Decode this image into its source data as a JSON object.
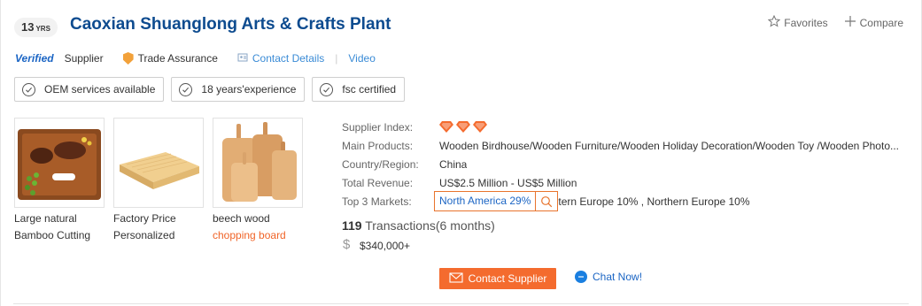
{
  "header": {
    "years_number": "13",
    "years_unit": "YRS",
    "company_name": "Caoxian Shuanglong Arts & Crafts Plant",
    "favorites_label": "Favorites",
    "compare_label": "Compare"
  },
  "meta": {
    "verified_label": "Verified",
    "supplier_label": "Supplier",
    "trade_assurance_label": "Trade Assurance",
    "contact_details_label": "Contact Details",
    "video_label": "Video"
  },
  "tags": [
    {
      "label": "OEM services available"
    },
    {
      "label": "18 years'experience"
    },
    {
      "label": "fsc certified"
    }
  ],
  "products": [
    {
      "line1": "Large natural",
      "line2": "Bamboo Cutting"
    },
    {
      "line1": "Factory Price",
      "line2": "Personalized"
    },
    {
      "line1": "beech wood",
      "line2": "chopping board"
    }
  ],
  "info": {
    "supplier_index_label": "Supplier Index:",
    "supplier_index_diamonds": 3,
    "main_products_label": "Main Products:",
    "main_products_value": "Wooden Birdhouse/Wooden Furniture/Wooden Holiday Decoration/Wooden Toy /Wooden Photo...",
    "country_label": "Country/Region:",
    "country_value": "China",
    "revenue_label": "Total Revenue:",
    "revenue_value": "US$2.5 Million - US$5 Million",
    "markets_label": "Top 3 Markets:",
    "markets_first": "North America 29%",
    "markets_rest": "tern Europe 10% , Northern Europe 10%"
  },
  "transactions": {
    "count": "119",
    "label": " Transactions(6 months)",
    "amount": "$340,000+"
  },
  "actions": {
    "contact_supplier_label": "Contact Supplier",
    "chat_now_label": "Chat Now!"
  },
  "colors": {
    "brand_blue": "#0d4b8f",
    "link_blue": "#3a8bd6",
    "accent_orange": "#f46b2e"
  }
}
